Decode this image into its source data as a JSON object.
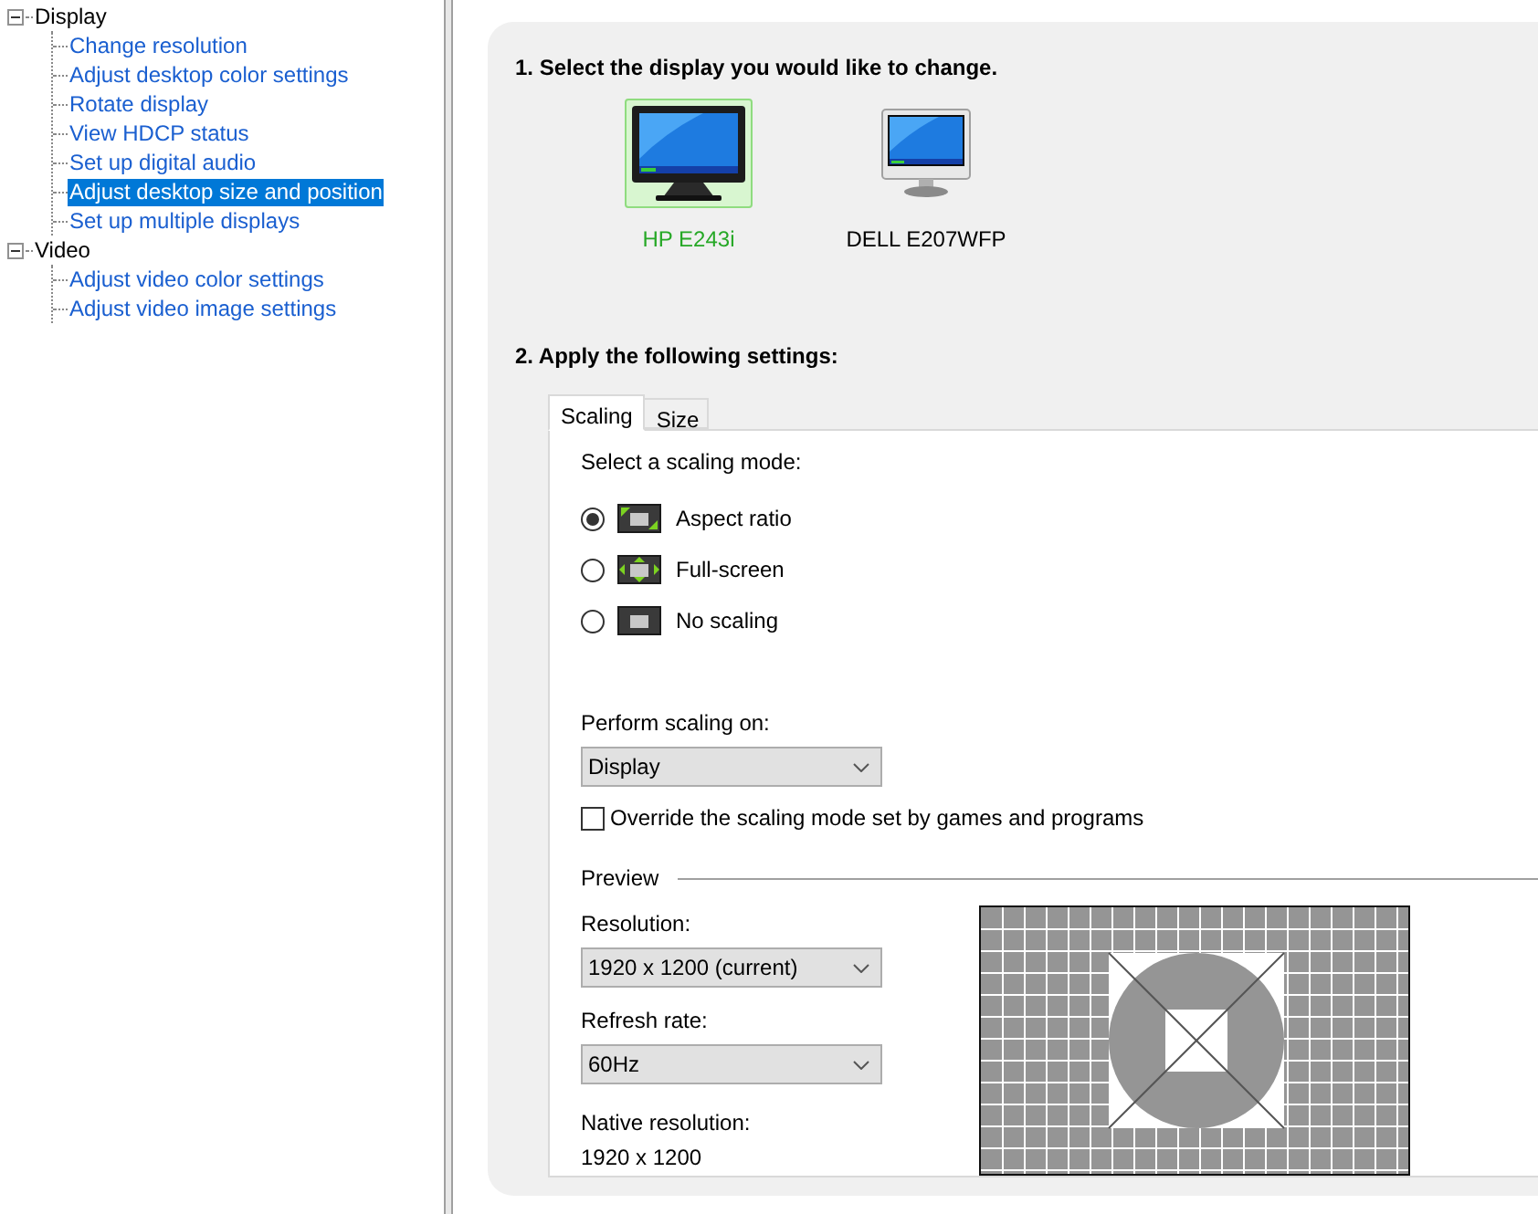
{
  "tree": [
    {
      "label": "Display",
      "expanded": true,
      "children": [
        {
          "label": "Change resolution",
          "selected": false
        },
        {
          "label": "Adjust desktop color settings",
          "selected": false
        },
        {
          "label": "Rotate display",
          "selected": false
        },
        {
          "label": "View HDCP status",
          "selected": false
        },
        {
          "label": "Set up digital audio",
          "selected": false
        },
        {
          "label": "Adjust desktop size and position",
          "selected": true
        },
        {
          "label": "Set up multiple displays",
          "selected": false
        }
      ]
    },
    {
      "label": "Video",
      "expanded": true,
      "children": [
        {
          "label": "Adjust video color settings",
          "selected": false
        },
        {
          "label": "Adjust video image settings",
          "selected": false
        }
      ]
    }
  ],
  "step1": {
    "heading": "1. Select the display you would like to change.",
    "displays": [
      {
        "name": "HP E243i",
        "kind": "black",
        "selected": true
      },
      {
        "name": "DELL E207WFP",
        "kind": "silver",
        "selected": false
      }
    ]
  },
  "step2": {
    "heading": "2. Apply the following settings:",
    "tabs": [
      {
        "label": "Scaling",
        "selected": true
      },
      {
        "label": "Size",
        "selected": false
      }
    ],
    "mode_prompt": "Select a scaling mode:",
    "modes": [
      {
        "label": "Aspect ratio",
        "kind": "aspect",
        "selected": true
      },
      {
        "label": "Full-screen",
        "kind": "full",
        "selected": false
      },
      {
        "label": "No scaling",
        "kind": "none",
        "selected": false
      }
    ],
    "perform_label": "Perform scaling on:",
    "perform_value": "Display",
    "override": {
      "label": "Override the scaling mode set by games and programs",
      "checked": false
    },
    "preview": {
      "title": "Preview",
      "resolution_label": "Resolution:",
      "resolution_value": "1920 x 1200 (current)",
      "refresh_label": "Refresh rate:",
      "refresh_value": "60Hz",
      "native_label": "Native resolution:",
      "native_value": "1920 x 1200"
    }
  }
}
